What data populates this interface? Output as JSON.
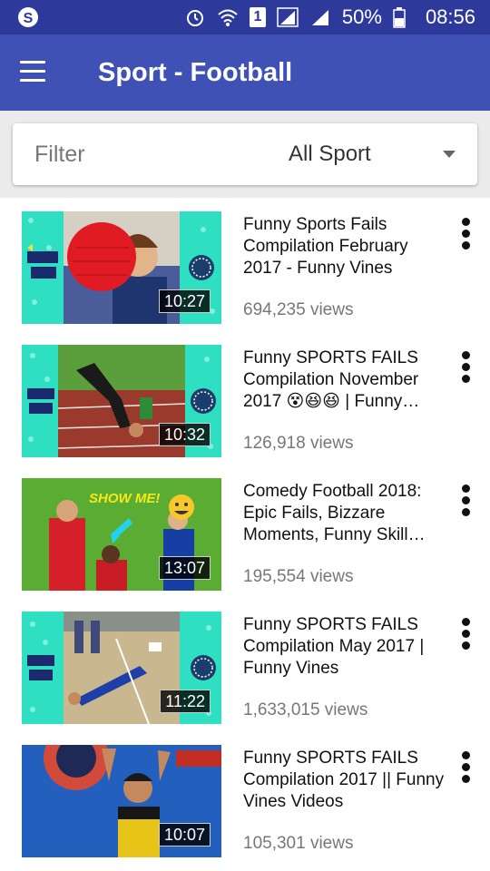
{
  "status_bar": {
    "battery": "50%",
    "time": "08:56",
    "sim": "1"
  },
  "app_bar": {
    "title": "Sport - Football"
  },
  "filter": {
    "label": "Filter",
    "selected": "All Sport"
  },
  "videos": [
    {
      "title": "Funny Sports Fails Compilation February 2017 - Funny Vines",
      "views": "694,235 views",
      "duration": "10:27",
      "badge_text": "FUNNY VINES"
    },
    {
      "title": "Funny SPORTS FAILS Compilation November 2017 😵😆😆 | Funny…",
      "views": "126,918 views",
      "duration": "10:32",
      "badge_text": "FUNNY VINES"
    },
    {
      "title": "Comedy Football 2018: Epic Fails, Bizzare Moments, Funny Skill…",
      "views": "195,554 views",
      "duration": "13:07",
      "overlay_text": "SHOW ME!"
    },
    {
      "title": "Funny SPORTS FAILS Compilation May 2017 | Funny Vines",
      "views": "1,633,015 views",
      "duration": "11:22",
      "badge_text": "FUNNY VINES"
    },
    {
      "title": "Funny SPORTS FAILS Compilation 2017 || Funny Vines Videos",
      "views": "105,301 views",
      "duration": "10:07"
    }
  ],
  "colors": {
    "status_bar": "#2d3a9c",
    "app_bar": "#3f51b5",
    "thumb_teal": "#2ee0c1"
  },
  "icons": {
    "status_left": "skype-icon",
    "menu": "hamburger-menu-icon",
    "more": "more-vertical-icon",
    "dropdown": "dropdown-arrow-icon"
  }
}
